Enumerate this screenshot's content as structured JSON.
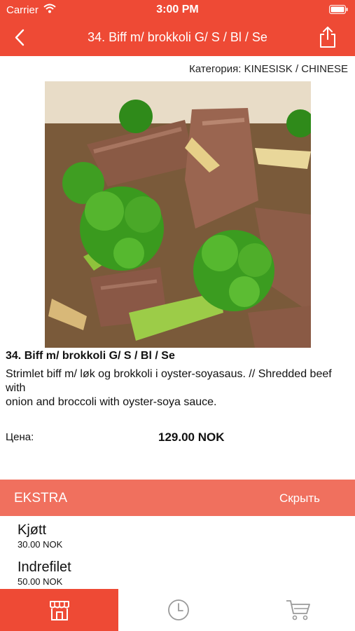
{
  "status_bar": {
    "carrier": "Carrier",
    "time": "3:00 PM"
  },
  "nav": {
    "title": "34. Biff m/ brokkoli G/ S / Bl / Se",
    "back_icon": "chevron-left-icon",
    "share_icon": "share-icon"
  },
  "product": {
    "category": "Категория: KINESISK / CHINESE",
    "name": "34. Biff m/ brokkoli G/ S / Bl / Se",
    "description": "Strimlet biff m/ løk og brokkoli i oyster-soyasaus. // Shredded beef with\nonion and broccoli with oyster-soya sauce.",
    "price_label": "Цена:",
    "price": "129.00 NOK"
  },
  "extras": {
    "header": "EKSTRA",
    "toggle_label": "Скрыть",
    "items": [
      {
        "name": "Kjøtt",
        "price": "30.00 NOK"
      },
      {
        "name": "Indrefilet",
        "price": "50.00 NOK"
      }
    ]
  },
  "tabbar": {
    "tabs": [
      {
        "icon": "store-icon",
        "active": true
      },
      {
        "icon": "clock-icon",
        "active": false
      },
      {
        "icon": "cart-icon",
        "active": false
      }
    ]
  },
  "colors": {
    "brand": "#ee4a35",
    "extra_bar": "#f0705e"
  }
}
